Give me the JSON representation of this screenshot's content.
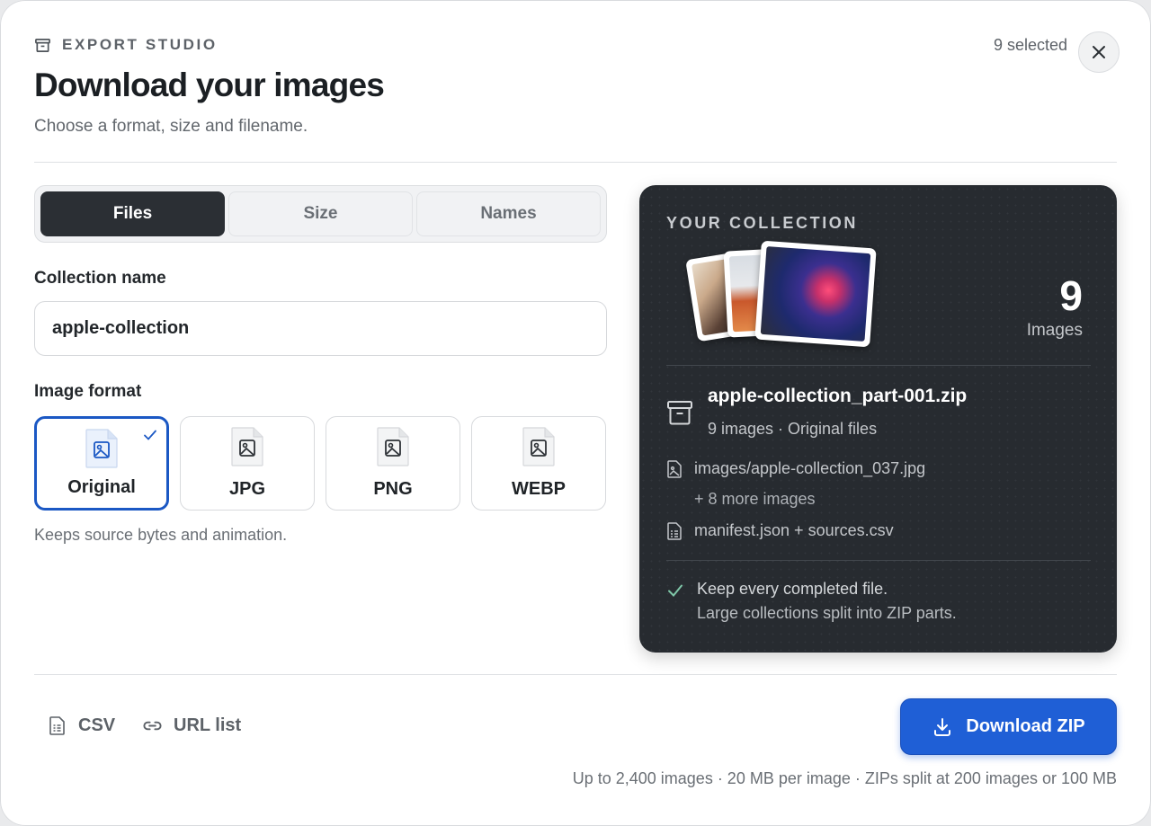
{
  "header": {
    "eyebrow": "EXPORT STUDIO",
    "title": "Download your images",
    "subtitle": "Choose a format, size and filename.",
    "selected_count": "9 selected",
    "close_icon": "close-icon"
  },
  "tabs": [
    {
      "label": "Files",
      "active": true
    },
    {
      "label": "Size",
      "active": false
    },
    {
      "label": "Names",
      "active": false
    }
  ],
  "collection": {
    "label": "Collection name",
    "value": "apple-collection",
    "placeholder": ""
  },
  "format": {
    "label": "Image format",
    "options": [
      {
        "label": "Original",
        "selected": true
      },
      {
        "label": "JPG",
        "selected": false
      },
      {
        "label": "PNG",
        "selected": false
      },
      {
        "label": "WEBP",
        "selected": false
      }
    ],
    "hint": "Keeps source bytes and animation."
  },
  "panel": {
    "eyebrow": "YOUR COLLECTION",
    "count": "9",
    "count_label": "Images",
    "zip_name": "apple-collection_part-001.zip",
    "zip_meta": "9 images · Original files",
    "file_1": "images/apple-collection_037.jpg",
    "more": "+ 8 more images",
    "manifest": "manifest.json + sources.csv",
    "note_1": "Keep every completed file.",
    "note_2": "Large collections split into ZIP parts."
  },
  "footer": {
    "csv_label": "CSV",
    "url_list_label": "URL list",
    "download_label": "Download ZIP",
    "limits": "Up to 2,400 images · 20 MB per image · ZIPs split at 200 images or 100 MB"
  },
  "colors": {
    "accent": "#1f5fd6",
    "panel_bg": "#272b30",
    "active_tab": "#2b2f34",
    "check_green": "#7fc7a8"
  }
}
